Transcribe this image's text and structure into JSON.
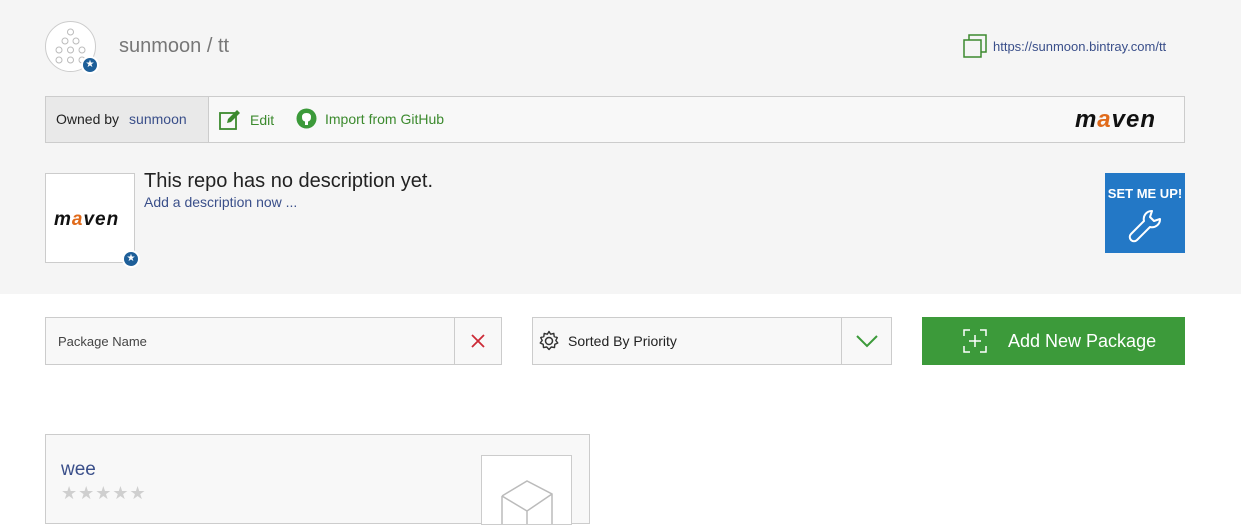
{
  "header": {
    "repo_title": "sunmoon / tt",
    "url": "https://sunmoon.bintray.com/tt"
  },
  "toolbar": {
    "owned_by_label": "Owned by",
    "owner": "sunmoon",
    "edit_label": "Edit",
    "import_label": "Import from GitHub",
    "type_logo": "maven"
  },
  "description": {
    "text": "This repo has no description yet.",
    "add_link": "Add a description now ...",
    "logo": "maven"
  },
  "setme": {
    "label": "SET ME UP!"
  },
  "filters": {
    "search_placeholder": "Package Name",
    "sort_label": "Sorted By Priority",
    "add_package_label": "Add New Package"
  },
  "packages": [
    {
      "name": "wee",
      "rating": 0,
      "max_rating": 5
    }
  ],
  "colors": {
    "accent_green": "#3c9a3a",
    "link_blue": "#3a4f8a",
    "setme_blue": "#2378c6",
    "clear_red": "#cc2a36"
  }
}
